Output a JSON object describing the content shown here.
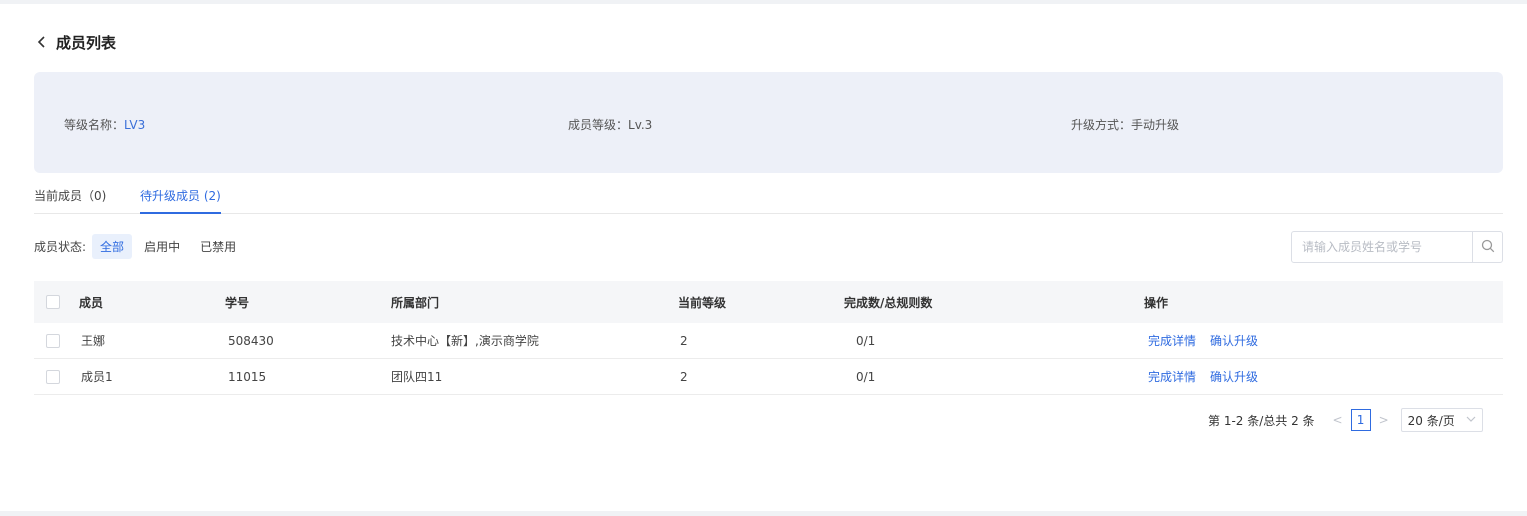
{
  "header": {
    "back_icon": "chevron-left-icon",
    "title": "成员列表"
  },
  "info": {
    "level_name_label": "等级名称：",
    "level_name_value": "LV3",
    "member_level_label": "成员等级：",
    "member_level_value": "Lv.3",
    "upgrade_method_label": "升级方式：",
    "upgrade_method_value": "手动升级"
  },
  "tabs": [
    {
      "label": "当前成员（0)"
    },
    {
      "label": "待升级成员 (2)"
    }
  ],
  "active_tab_index": 1,
  "filter": {
    "label": "成员状态:",
    "options": [
      "全部",
      "启用中",
      "已禁用"
    ],
    "selected": "全部"
  },
  "search": {
    "placeholder": "请输入成员姓名或学号",
    "value": "",
    "icon": "search-icon"
  },
  "table": {
    "columns": [
      "成员",
      "学号",
      "所属部门",
      "当前等级",
      "完成数/总规则数",
      "操作"
    ],
    "rows": [
      {
        "name": "王娜",
        "student_id": "508430",
        "department": "技术中心【新】,演示商学院",
        "level": "2",
        "progress": "0/1",
        "actions": [
          "完成详情",
          "确认升级"
        ]
      },
      {
        "name": "成员1",
        "student_id": "11015",
        "department": "团队四11",
        "level": "2",
        "progress": "0/1",
        "actions": [
          "完成详情",
          "确认升级"
        ]
      }
    ]
  },
  "pagination": {
    "summary": "第 1-2 条/总共 2 条",
    "current_page": "1",
    "page_size": "20 条/页"
  },
  "colors": {
    "accent": "#2f6be0",
    "info_bg": "#edf0f8"
  }
}
